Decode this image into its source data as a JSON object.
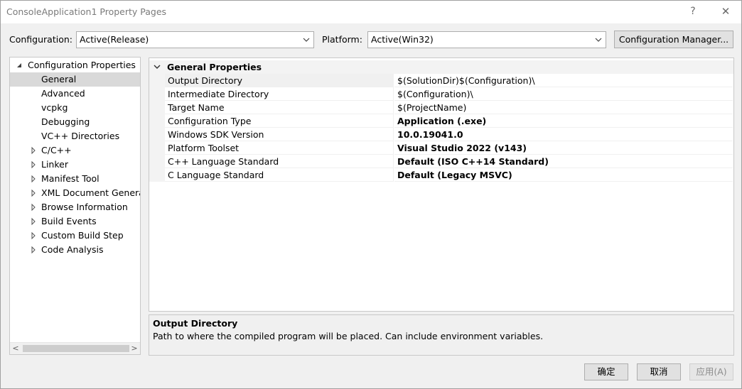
{
  "window": {
    "title": "ConsoleApplication1 Property Pages",
    "help_glyph": "?",
    "close_glyph": "✕"
  },
  "config_bar": {
    "configuration_label": "Configuration:",
    "configuration_value": "Active(Release)",
    "platform_label": "Platform:",
    "platform_value": "Active(Win32)",
    "config_manager_label": "Configuration Manager..."
  },
  "tree": {
    "root": "Configuration Properties",
    "items": [
      {
        "label": "General",
        "expandable": false,
        "selected": true
      },
      {
        "label": "Advanced",
        "expandable": false
      },
      {
        "label": "vcpkg",
        "expandable": false
      },
      {
        "label": "Debugging",
        "expandable": false
      },
      {
        "label": "VC++ Directories",
        "expandable": false
      },
      {
        "label": "C/C++",
        "expandable": true
      },
      {
        "label": "Linker",
        "expandable": true
      },
      {
        "label": "Manifest Tool",
        "expandable": true
      },
      {
        "label": "XML Document Generat",
        "expandable": true
      },
      {
        "label": "Browse Information",
        "expandable": true
      },
      {
        "label": "Build Events",
        "expandable": true
      },
      {
        "label": "Custom Build Step",
        "expandable": true
      },
      {
        "label": "Code Analysis",
        "expandable": true
      }
    ],
    "scroll_left": "<",
    "scroll_right": ">"
  },
  "grid": {
    "section": "General Properties",
    "rows": [
      {
        "name": "Output Directory",
        "value": "$(SolutionDir)$(Configuration)\\",
        "bold": false
      },
      {
        "name": "Intermediate Directory",
        "value": "$(Configuration)\\",
        "bold": false
      },
      {
        "name": "Target Name",
        "value": "$(ProjectName)",
        "bold": false
      },
      {
        "name": "Configuration Type",
        "value": "Application (.exe)",
        "bold": true
      },
      {
        "name": "Windows SDK Version",
        "value": "10.0.19041.0",
        "bold": true
      },
      {
        "name": "Platform Toolset",
        "value": "Visual Studio 2022 (v143)",
        "bold": true
      },
      {
        "name": "C++ Language Standard",
        "value": "Default (ISO C++14 Standard)",
        "bold": true
      },
      {
        "name": "C Language Standard",
        "value": "Default (Legacy MSVC)",
        "bold": true
      }
    ]
  },
  "description": {
    "title": "Output Directory",
    "text": "Path to where the compiled program will be placed. Can include environment variables."
  },
  "footer": {
    "ok_label": "确定",
    "cancel_label": "取消",
    "apply_label": "应用(A)"
  }
}
